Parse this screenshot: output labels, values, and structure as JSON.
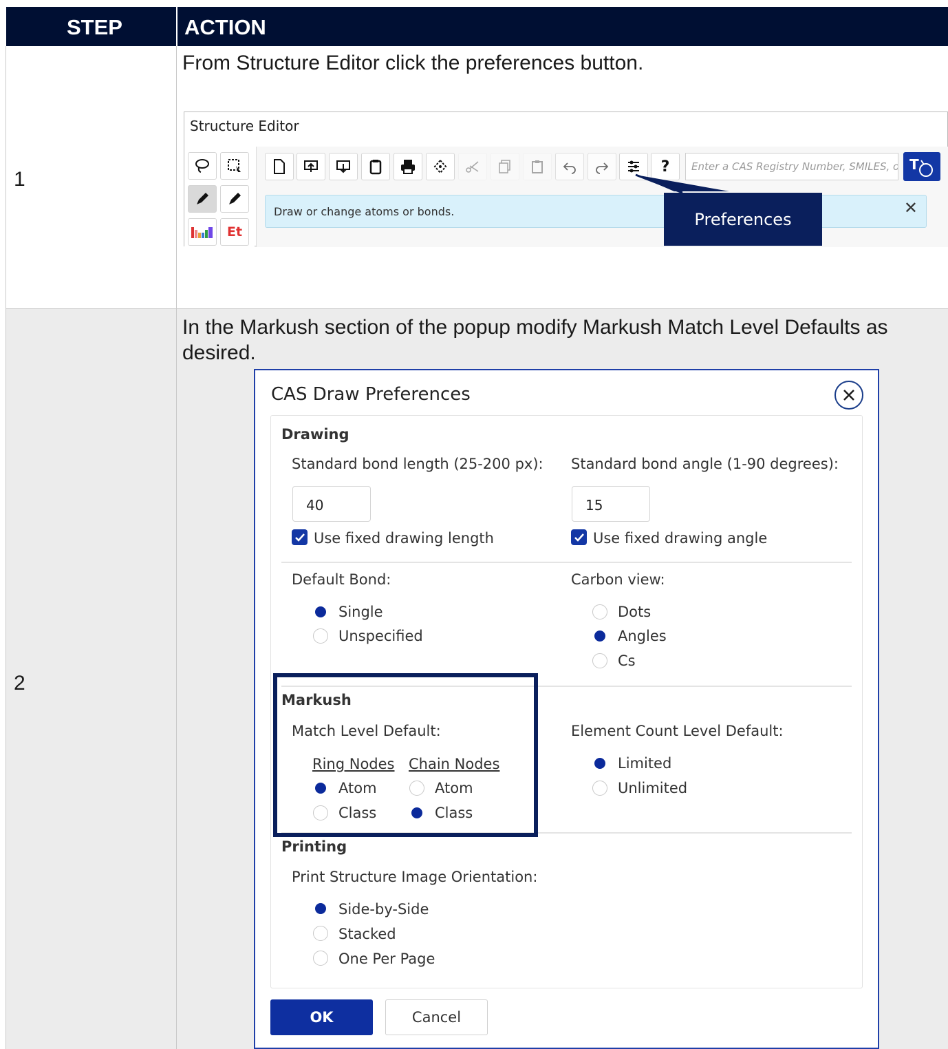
{
  "table": {
    "header": {
      "step": "STEP",
      "action": "ACTION"
    },
    "rows": [
      {
        "step": "1",
        "instruction": "From Structure Editor click the preferences button.",
        "editor": {
          "title": "Structure Editor",
          "search_placeholder": "Enter a CAS Registry Number, SMILES, or Ir",
          "info_message": "Draw or change atoms or bonds.",
          "callout": "Preferences",
          "et_label": "Et"
        }
      },
      {
        "step": "2",
        "instruction": "In the Markush section of the popup modify Markush Match Level Defaults as desired.",
        "dialog": {
          "title": "CAS Draw Preferences",
          "drawing": {
            "heading": "Drawing",
            "bond_length_label": "Standard bond length (25-200 px):",
            "bond_length_value": "40",
            "bond_angle_label": "Standard bond angle (1-90 degrees):",
            "bond_angle_value": "15",
            "fixed_length_label": "Use fixed drawing length",
            "fixed_length_checked": true,
            "fixed_angle_label": "Use fixed drawing angle",
            "fixed_angle_checked": true,
            "default_bond_label": "Default Bond:",
            "default_bond_options": [
              "Single",
              "Unspecified"
            ],
            "default_bond_selected": "Single",
            "carbon_view_label": "Carbon view:",
            "carbon_view_options": [
              "Dots",
              "Angles",
              "Cs"
            ],
            "carbon_view_selected": "Angles"
          },
          "markush": {
            "heading": "Markush",
            "match_level_label": "Match Level Default:",
            "ring_nodes_label": "Ring Nodes",
            "chain_nodes_label": "Chain Nodes",
            "ring_atom": "Atom",
            "ring_class": "Class",
            "ring_selected": "Atom",
            "chain_atom": "Atom",
            "chain_class": "Class",
            "chain_selected": "Class",
            "element_count_label": "Element Count Level Default:",
            "element_count_options": [
              "Limited",
              "Unlimited"
            ],
            "element_count_selected": "Limited"
          },
          "printing": {
            "heading": "Printing",
            "orientation_label": "Print Structure Image Orientation:",
            "options": [
              "Side-by-Side",
              "Stacked",
              "One Per Page"
            ],
            "selected": "Side-by-Side"
          },
          "ok_label": "OK",
          "cancel_label": "Cancel"
        }
      }
    ]
  },
  "colors": {
    "header_bg": "#000f33",
    "highlight_border": "#0a1f5c",
    "primary_button": "#0e2fa0",
    "info_bg": "#d9f1fb",
    "row2_bg": "#ececec"
  }
}
